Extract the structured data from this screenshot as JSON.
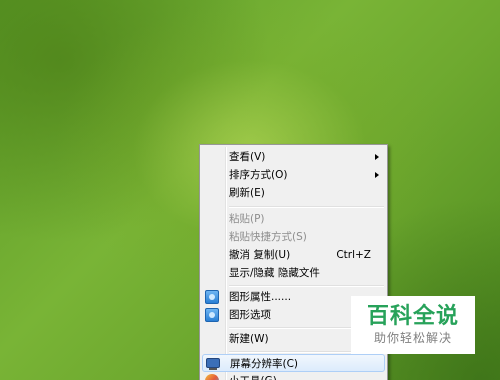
{
  "context_menu": {
    "items": [
      {
        "label": "查看(V)"
      },
      {
        "label": "排序方式(O)"
      },
      {
        "label": "刷新(E)"
      },
      {
        "label": "粘贴(P)"
      },
      {
        "label": "粘贴快捷方式(S)"
      },
      {
        "label": "撤消 复制(U)",
        "shortcut": "Ctrl+Z"
      },
      {
        "label": "显示/隐藏 隐藏文件"
      },
      {
        "label": "图形属性......"
      },
      {
        "label": "图形选项"
      },
      {
        "label": "新建(W)"
      },
      {
        "label": "屏幕分辨率(C)"
      },
      {
        "label": "小工具(G)"
      }
    ]
  },
  "watermark": {
    "title": "百科全说",
    "subtitle": "助你轻松解决"
  },
  "colors": {
    "menu_background": "#f0f0f0",
    "highlight": "#dcebfc",
    "disabled_text": "#8d8d8d",
    "watermark_green": "#27a25a"
  },
  "icons": {
    "graphics_properties": "intel-graphics-icon",
    "graphics_options": "intel-graphics-icon",
    "screen_resolution": "monitor-icon",
    "gadgets": "gadgets-icon"
  }
}
